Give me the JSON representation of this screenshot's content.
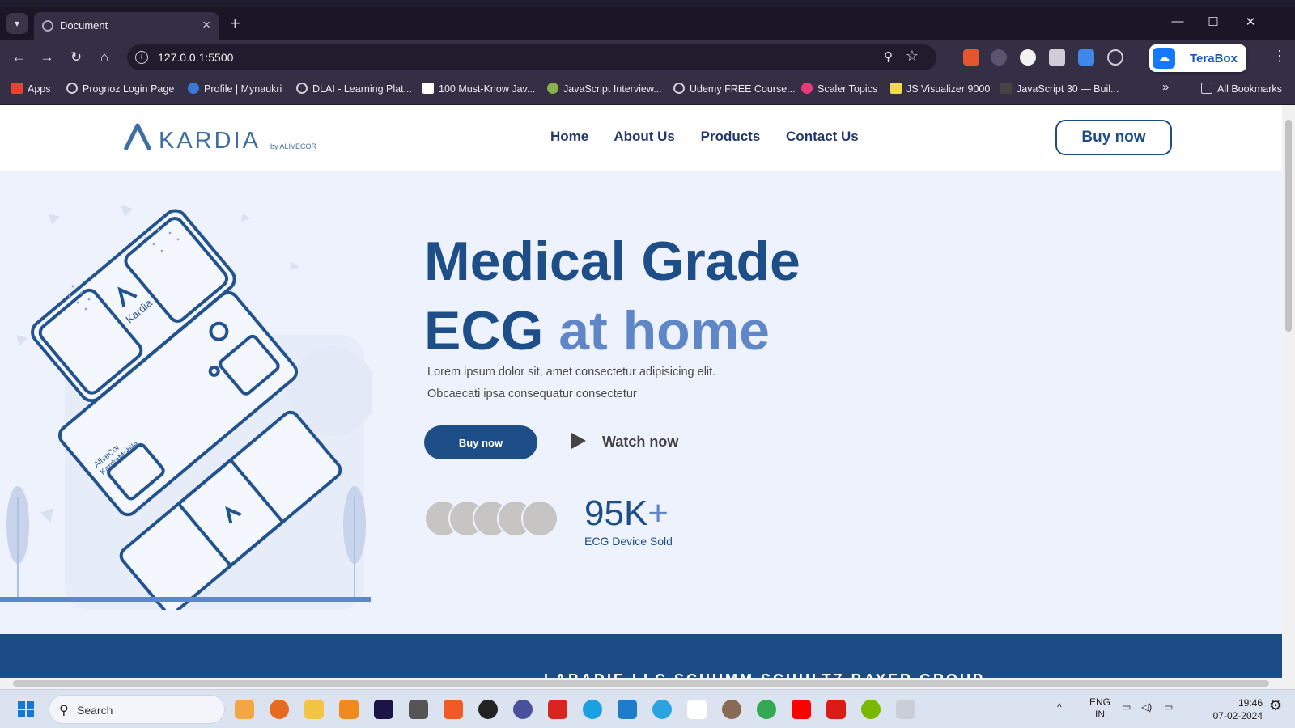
{
  "browser": {
    "tab_title": "Document",
    "url": "127.0.0.1:5500",
    "bookmarks": [
      "Apps",
      "Prognoz Login Page",
      "Profile | Mynaukri",
      "DLAI - Learning Plat...",
      "100 Must-Know Jav...",
      "JavaScript Interview...",
      "Udemy FREE Course...",
      "Scaler Topics",
      "JS Visualizer 9000",
      "JavaScript 30 — Buil...",
      "All Bookmarks"
    ],
    "extension_label": "TeraBox"
  },
  "site": {
    "logo_word": "KARDIA",
    "logo_by": "by ALIVECOR",
    "nav": [
      "Home",
      "About Us",
      "Products",
      "Contact Us"
    ],
    "nav_cta": "Buy now",
    "hero": {
      "line1": "Medical Grade",
      "line2_dark": "ECG",
      "line2_light": "at home",
      "desc1": "Lorem ipsum dolor sit, amet consectetur adipisicing elit.",
      "desc2": "Obcaecati ipsa consequatur consectetur",
      "buy_label": "Buy now",
      "watch_label": "Watch now",
      "stat_number": "95K",
      "stat_plus": "+",
      "stat_label": "ECG Device Sold"
    },
    "illustration": {
      "device_label_1": "Kardia",
      "device_label_2": "AliveCor",
      "device_label_3": "KardiaMobile"
    },
    "band_partners": "LABADIE LLC    SCHUMM SCHULTZ    BAYER GROUP"
  },
  "taskbar": {
    "search": "Search",
    "lang_top": "ENG",
    "lang_bottom": "IN",
    "time": "19:46",
    "date": "07-02-2024"
  },
  "colors": {
    "brand_dark": "#1d4e88",
    "brand_light": "#5f86c6",
    "hero_bg": "#eef2fc"
  }
}
